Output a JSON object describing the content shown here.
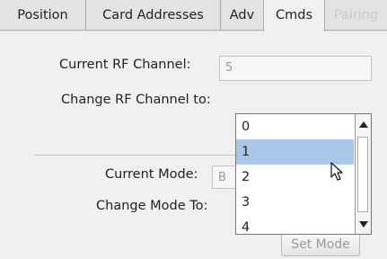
{
  "tabs": [
    {
      "label": "Position",
      "state": "normal"
    },
    {
      "label": "Card Addresses",
      "state": "normal"
    },
    {
      "label": "Adv",
      "state": "normal"
    },
    {
      "label": "Cmds",
      "state": "active"
    },
    {
      "label": "Pairing",
      "state": "disabled"
    }
  ],
  "rf": {
    "current_label": "Current RF Channel:",
    "current_value": "5",
    "change_label": "Change RF Channel to:",
    "options": [
      "0",
      "1",
      "2",
      "3",
      "4"
    ],
    "selected_option": "1"
  },
  "mode": {
    "current_label": "Current Mode:",
    "current_value": "B",
    "change_label": "Change Mode To:",
    "set_button": "Set Mode"
  },
  "icons": {
    "dropdown": "chevron-down-icon",
    "scroll_up": "scroll-up-arrow-icon",
    "scroll_down": "scroll-down-arrow-icon",
    "cursor": "mouse-pointer-icon"
  },
  "colors": {
    "selection": "#a9c7ea",
    "disabled_text": "#c9c9c9"
  }
}
